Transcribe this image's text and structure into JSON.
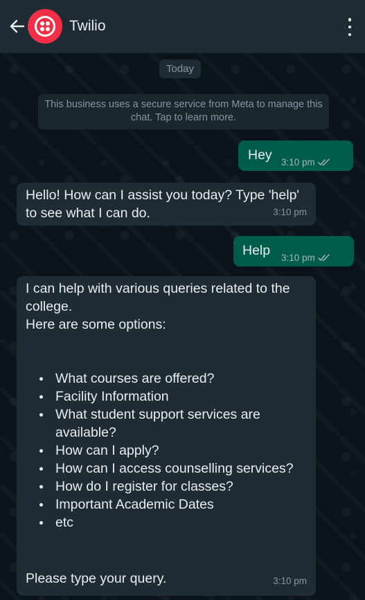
{
  "header": {
    "title": "Twilio",
    "back_icon": "arrow-left-icon",
    "avatar_icon": "twilio-logo",
    "menu_icon": "vertical-dots-icon"
  },
  "chat": {
    "date_label": "Today",
    "notice": "This business uses a secure service from Meta to manage this chat. Tap to learn more.",
    "messages": [
      {
        "direction": "outgoing",
        "text": "Hey",
        "time": "3:10 pm",
        "status": "read-double-tick"
      },
      {
        "direction": "incoming",
        "text": "Hello! How can I assist you today? Type 'help' to see what I can do.",
        "time": "3:10 pm"
      },
      {
        "direction": "outgoing",
        "text": "Help",
        "time": "3:10 pm",
        "status": "read-double-tick"
      },
      {
        "direction": "incoming",
        "intro_lines": [
          "I can help with various queries related to the college.",
          "Here are some options:"
        ],
        "options": [
          "What courses are offered?",
          "Facility Information",
          "What student support services are available?",
          "How can I apply?",
          "How can I access counselling services?",
          "How do I register for classes?",
          "Important Academic Dates",
          "etc"
        ],
        "closing": "Please type your query.",
        "time": "3:10 pm"
      }
    ]
  },
  "colors": {
    "background": "#0b141a",
    "header": "#1f2c34",
    "outgoing_bubble": "#005c4b",
    "incoming_bubble": "#1f2c34",
    "avatar": "#f22f46",
    "secondary_text": "#8696a0"
  }
}
